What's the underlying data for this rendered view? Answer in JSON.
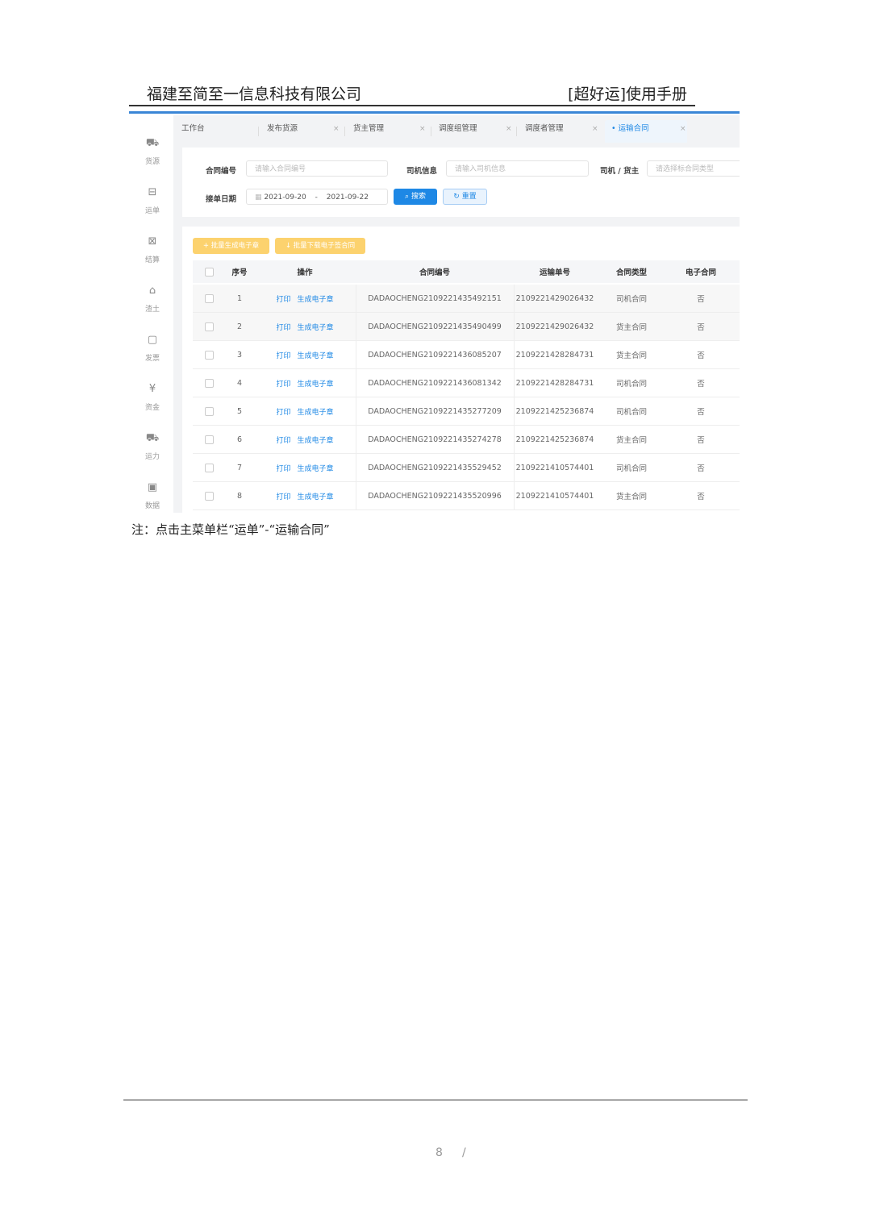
{
  "doc": {
    "header_left": "福建至简至一信息科技有限公司",
    "header_right": "[超好运]使用手册",
    "note": "注：点击主菜单栏“运单”-“运输合同”",
    "page_number": "8",
    "page_separator": "/"
  },
  "sidebar": {
    "items": [
      {
        "label": "货源",
        "icon": "truck-icon"
      },
      {
        "label": "运单",
        "icon": "document-icon"
      },
      {
        "label": "结算",
        "icon": "percent-icon"
      },
      {
        "label": "渣土",
        "icon": "basket-icon"
      },
      {
        "label": "发票",
        "icon": "invoice-icon"
      },
      {
        "label": "资金",
        "icon": "yuan-icon"
      },
      {
        "label": "运力",
        "icon": "vehicle-icon"
      },
      {
        "label": "数据",
        "icon": "chart-icon"
      }
    ]
  },
  "tabs": [
    {
      "label": "工作台",
      "closable": false
    },
    {
      "label": "发布货源",
      "closable": true
    },
    {
      "label": "货主管理",
      "closable": true
    },
    {
      "label": "调度组管理",
      "closable": true
    },
    {
      "label": "调度者管理",
      "closable": true
    },
    {
      "label": "运输合同",
      "closable": true,
      "active": true
    }
  ],
  "tab_close": "×",
  "filters": {
    "contract_no_label": "合同编号",
    "contract_no_placeholder": "请输入合同编号",
    "driver_label": "司机信息",
    "driver_placeholder": "请输入司机信息",
    "type_label": "司机 / 货主",
    "type_placeholder": "请选择标合同类型",
    "date_label": "接单日期",
    "date_start": "2021-09-20",
    "date_sep": "-",
    "date_end": "2021-09-22",
    "search_button": "搜索",
    "reset_button": "重置"
  },
  "actions": {
    "batch_generate": "批量生成电子章",
    "batch_download": "批量下载电子签合同"
  },
  "table": {
    "headers": [
      "序号",
      "操作",
      "合同编号",
      "运输单号",
      "合同类型",
      "电子合同"
    ],
    "action_print": "打印",
    "action_generate": "生成电子章",
    "rows": [
      {
        "no": "1",
        "contract": "DADAOCHENG2109221435492151",
        "waybill": "2109221429026432",
        "type": "司机合同",
        "e": "否"
      },
      {
        "no": "2",
        "contract": "DADAOCHENG2109221435490499",
        "waybill": "2109221429026432",
        "type": "货主合同",
        "e": "否"
      },
      {
        "no": "3",
        "contract": "DADAOCHENG2109221436085207",
        "waybill": "2109221428284731",
        "type": "货主合同",
        "e": "否"
      },
      {
        "no": "4",
        "contract": "DADAOCHENG2109221436081342",
        "waybill": "2109221428284731",
        "type": "司机合同",
        "e": "否"
      },
      {
        "no": "5",
        "contract": "DADAOCHENG2109221435277209",
        "waybill": "2109221425236874",
        "type": "司机合同",
        "e": "否"
      },
      {
        "no": "6",
        "contract": "DADAOCHENG2109221435274278",
        "waybill": "2109221425236874",
        "type": "货主合同",
        "e": "否"
      },
      {
        "no": "7",
        "contract": "DADAOCHENG2109221435529452",
        "waybill": "2109221410574401",
        "type": "司机合同",
        "e": "否"
      },
      {
        "no": "8",
        "contract": "DADAOCHENG2109221435520996",
        "waybill": "2109221410574401",
        "type": "货主合同",
        "e": "否"
      }
    ]
  },
  "colors": {
    "accent": "#1e88e5",
    "warning": "#fcd26e",
    "rule": "#3a86d6"
  }
}
